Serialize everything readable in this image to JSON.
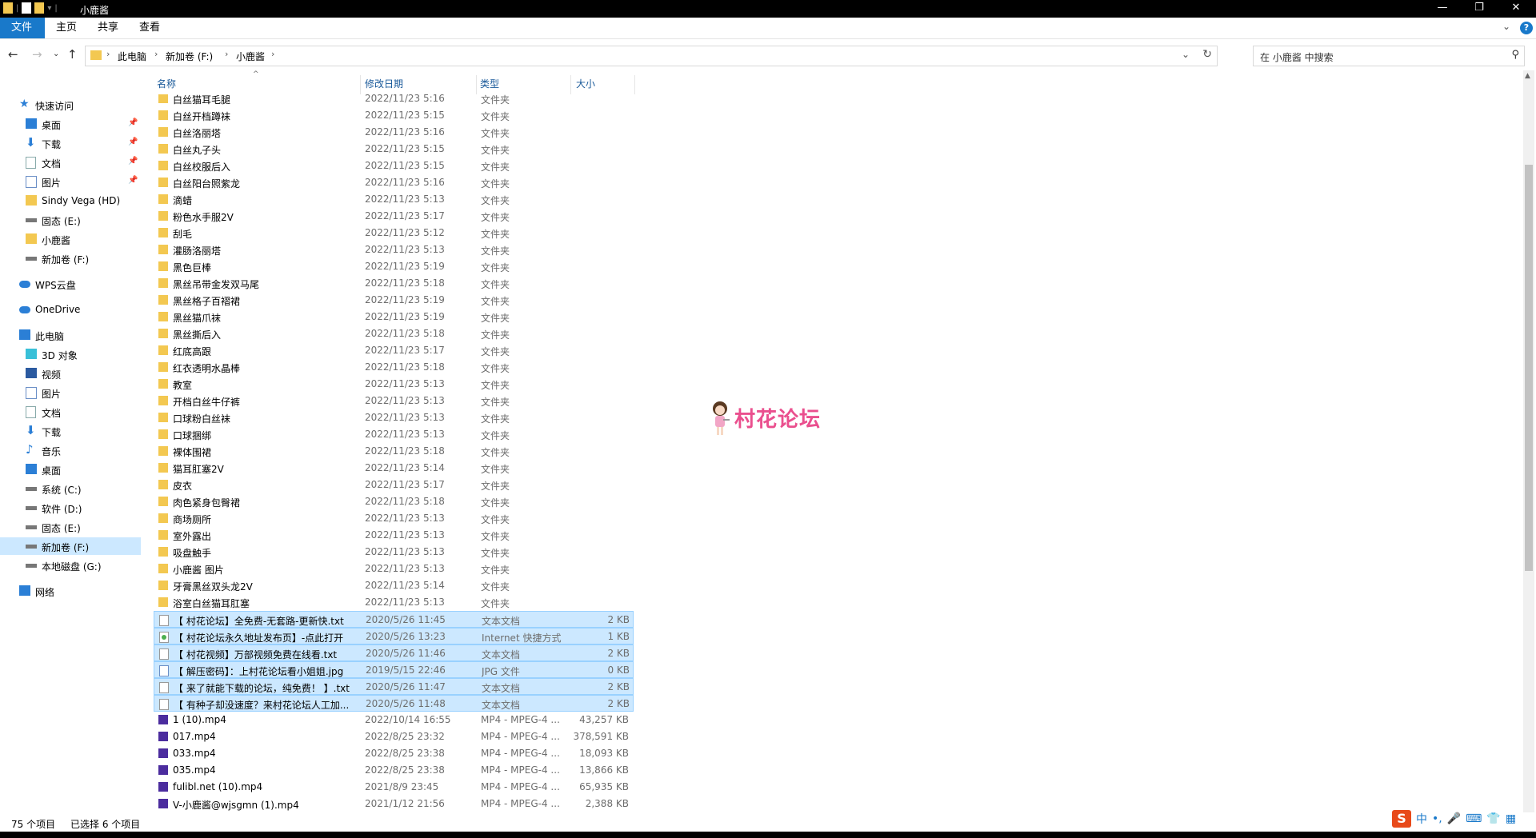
{
  "window": {
    "title": "小鹿酱"
  },
  "ribbon": {
    "tabs": [
      "文件",
      "主页",
      "共享",
      "查看"
    ]
  },
  "address": {
    "crumbs": [
      "此电脑",
      "新加卷 (F:)",
      "小鹿酱"
    ]
  },
  "search": {
    "placeholder": "在 小鹿酱 中搜索"
  },
  "sidebar": [
    {
      "label": "快速访问",
      "icon": "star-icon",
      "level": 0
    },
    {
      "label": "桌面",
      "icon": "desktop-icon",
      "level": 1,
      "pinned": true
    },
    {
      "label": "下载",
      "icon": "download-icon",
      "level": 1,
      "pinned": true
    },
    {
      "label": "文档",
      "icon": "document-icon",
      "level": 1,
      "pinned": true
    },
    {
      "label": "图片",
      "icon": "picture-icon",
      "level": 1,
      "pinned": true
    },
    {
      "label": "Sindy Vega (HD)",
      "icon": "folder-icon",
      "level": 1
    },
    {
      "label": "固态 (E:)",
      "icon": "drive-icon",
      "level": 1
    },
    {
      "label": "小鹿酱",
      "icon": "folder-icon",
      "level": 1
    },
    {
      "label": "新加卷 (F:)",
      "icon": "drive-icon",
      "level": 1
    },
    {
      "label": "WPS云盘",
      "icon": "cloud-icon",
      "level": 0
    },
    {
      "label": "OneDrive",
      "icon": "onedrive-icon",
      "level": 0
    },
    {
      "label": "此电脑",
      "icon": "computer-icon",
      "level": 0
    },
    {
      "label": "3D 对象",
      "icon": "cube-icon",
      "level": 1
    },
    {
      "label": "视频",
      "icon": "video-icon",
      "level": 1
    },
    {
      "label": "图片",
      "icon": "picture-icon",
      "level": 1
    },
    {
      "label": "文档",
      "icon": "document-icon",
      "level": 1
    },
    {
      "label": "下载",
      "icon": "download-icon",
      "level": 1
    },
    {
      "label": "音乐",
      "icon": "music-icon",
      "level": 1
    },
    {
      "label": "桌面",
      "icon": "desktop-icon",
      "level": 1
    },
    {
      "label": "系统 (C:)",
      "icon": "drive-icon",
      "level": 1
    },
    {
      "label": "软件 (D:)",
      "icon": "drive-icon",
      "level": 1
    },
    {
      "label": "固态 (E:)",
      "icon": "drive-icon",
      "level": 1
    },
    {
      "label": "新加卷 (F:)",
      "icon": "drive-icon",
      "level": 1,
      "selected": true
    },
    {
      "label": "本地磁盘 (G:)",
      "icon": "drive-icon",
      "level": 1
    },
    {
      "label": "网络",
      "icon": "network-icon",
      "level": 0
    }
  ],
  "columns": {
    "name": "名称",
    "date": "修改日期",
    "type": "类型",
    "size": "大小"
  },
  "files": [
    {
      "name": "白丝猫耳毛腿",
      "date": "2022/11/23 5:16",
      "type": "文件夹",
      "size": "",
      "kind": "folder"
    },
    {
      "name": "白丝开档蹲袜",
      "date": "2022/11/23 5:15",
      "type": "文件夹",
      "size": "",
      "kind": "folder"
    },
    {
      "name": "白丝洛丽塔",
      "date": "2022/11/23 5:16",
      "type": "文件夹",
      "size": "",
      "kind": "folder"
    },
    {
      "name": "白丝丸子头",
      "date": "2022/11/23 5:15",
      "type": "文件夹",
      "size": "",
      "kind": "folder"
    },
    {
      "name": "白丝校服后入",
      "date": "2022/11/23 5:15",
      "type": "文件夹",
      "size": "",
      "kind": "folder"
    },
    {
      "name": "白丝阳台照紫龙",
      "date": "2022/11/23 5:16",
      "type": "文件夹",
      "size": "",
      "kind": "folder"
    },
    {
      "name": "滴蜡",
      "date": "2022/11/23 5:13",
      "type": "文件夹",
      "size": "",
      "kind": "folder"
    },
    {
      "name": "粉色水手服2V",
      "date": "2022/11/23 5:17",
      "type": "文件夹",
      "size": "",
      "kind": "folder"
    },
    {
      "name": "刮毛",
      "date": "2022/11/23 5:12",
      "type": "文件夹",
      "size": "",
      "kind": "folder"
    },
    {
      "name": "灌肠洛丽塔",
      "date": "2022/11/23 5:13",
      "type": "文件夹",
      "size": "",
      "kind": "folder"
    },
    {
      "name": "黑色巨棒",
      "date": "2022/11/23 5:19",
      "type": "文件夹",
      "size": "",
      "kind": "folder"
    },
    {
      "name": "黑丝吊带金发双马尾",
      "date": "2022/11/23 5:18",
      "type": "文件夹",
      "size": "",
      "kind": "folder"
    },
    {
      "name": "黑丝格子百褶裙",
      "date": "2022/11/23 5:19",
      "type": "文件夹",
      "size": "",
      "kind": "folder"
    },
    {
      "name": "黑丝猫爪袜",
      "date": "2022/11/23 5:19",
      "type": "文件夹",
      "size": "",
      "kind": "folder"
    },
    {
      "name": "黑丝撕后入",
      "date": "2022/11/23 5:18",
      "type": "文件夹",
      "size": "",
      "kind": "folder"
    },
    {
      "name": "红底高跟",
      "date": "2022/11/23 5:17",
      "type": "文件夹",
      "size": "",
      "kind": "folder"
    },
    {
      "name": "红衣透明水晶棒",
      "date": "2022/11/23 5:18",
      "type": "文件夹",
      "size": "",
      "kind": "folder"
    },
    {
      "name": "教室",
      "date": "2022/11/23 5:13",
      "type": "文件夹",
      "size": "",
      "kind": "folder"
    },
    {
      "name": "开档白丝牛仔裤",
      "date": "2022/11/23 5:13",
      "type": "文件夹",
      "size": "",
      "kind": "folder"
    },
    {
      "name": "口球粉白丝袜",
      "date": "2022/11/23 5:13",
      "type": "文件夹",
      "size": "",
      "kind": "folder"
    },
    {
      "name": "口球捆绑",
      "date": "2022/11/23 5:13",
      "type": "文件夹",
      "size": "",
      "kind": "folder"
    },
    {
      "name": "裸体围裙",
      "date": "2022/11/23 5:18",
      "type": "文件夹",
      "size": "",
      "kind": "folder"
    },
    {
      "name": "猫耳肛塞2V",
      "date": "2022/11/23 5:14",
      "type": "文件夹",
      "size": "",
      "kind": "folder"
    },
    {
      "name": "皮衣",
      "date": "2022/11/23 5:17",
      "type": "文件夹",
      "size": "",
      "kind": "folder"
    },
    {
      "name": "肉色紧身包臀裙",
      "date": "2022/11/23 5:18",
      "type": "文件夹",
      "size": "",
      "kind": "folder"
    },
    {
      "name": "商场厕所",
      "date": "2022/11/23 5:13",
      "type": "文件夹",
      "size": "",
      "kind": "folder"
    },
    {
      "name": "室外露出",
      "date": "2022/11/23 5:13",
      "type": "文件夹",
      "size": "",
      "kind": "folder"
    },
    {
      "name": "吸盘触手",
      "date": "2022/11/23 5:13",
      "type": "文件夹",
      "size": "",
      "kind": "folder"
    },
    {
      "name": "小鹿酱 图片",
      "date": "2022/11/23 5:13",
      "type": "文件夹",
      "size": "",
      "kind": "folder"
    },
    {
      "name": "牙膏黑丝双头龙2V",
      "date": "2022/11/23 5:14",
      "type": "文件夹",
      "size": "",
      "kind": "folder"
    },
    {
      "name": "浴室白丝猫耳肛塞",
      "date": "2022/11/23 5:13",
      "type": "文件夹",
      "size": "",
      "kind": "folder"
    },
    {
      "name": "【 村花论坛】全免费-无套路-更新快.txt",
      "date": "2020/5/26 11:45",
      "type": "文本文档",
      "size": "2 KB",
      "kind": "txt",
      "selected": true
    },
    {
      "name": "【 村花论坛永久地址发布页】-点此打开",
      "date": "2020/5/26 13:23",
      "type": "Internet 快捷方式",
      "size": "1 KB",
      "kind": "url",
      "selected": true
    },
    {
      "name": "【 村花视频】万部视频免费在线看.txt",
      "date": "2020/5/26 11:46",
      "type": "文本文档",
      "size": "2 KB",
      "kind": "txt",
      "selected": true
    },
    {
      "name": "【 解压密码】：上村花论坛看小姐姐.jpg",
      "date": "2019/5/15 22:46",
      "type": "JPG 文件",
      "size": "0 KB",
      "kind": "jpg",
      "selected": true
    },
    {
      "name": "【 来了就能下载的论坛，纯免费！ 】.txt",
      "date": "2020/5/26 11:47",
      "type": "文本文档",
      "size": "2 KB",
      "kind": "txt",
      "selected": true
    },
    {
      "name": "【 有种子却没速度？来村花论坛人工加...",
      "date": "2020/5/26 11:48",
      "type": "文本文档",
      "size": "2 KB",
      "kind": "txt",
      "selected": true
    },
    {
      "name": "1 (10).mp4",
      "date": "2022/10/14 16:55",
      "type": "MP4 - MPEG-4 ...",
      "size": "43,257 KB",
      "kind": "mp4"
    },
    {
      "name": "017.mp4",
      "date": "2022/8/25 23:32",
      "type": "MP4 - MPEG-4 ...",
      "size": "378,591 KB",
      "kind": "mp4"
    },
    {
      "name": "033.mp4",
      "date": "2022/8/25 23:38",
      "type": "MP4 - MPEG-4 ...",
      "size": "18,093 KB",
      "kind": "mp4"
    },
    {
      "name": "035.mp4",
      "date": "2022/8/25 23:38",
      "type": "MP4 - MPEG-4 ...",
      "size": "13,866 KB",
      "kind": "mp4"
    },
    {
      "name": "fulibl.net (10).mp4",
      "date": "2021/8/9 23:45",
      "type": "MP4 - MPEG-4 ...",
      "size": "65,935 KB",
      "kind": "mp4"
    },
    {
      "name": "V-小鹿酱@wjsgmn (1).mp4",
      "date": "2021/1/12 21:56",
      "type": "MP4 - MPEG-4 ...",
      "size": "2,388 KB",
      "kind": "mp4"
    }
  ],
  "status": {
    "count": "75 个项目",
    "selected": "已选择 6 个项目"
  },
  "watermark": {
    "text": "村花论坛"
  },
  "ime": {
    "mode": "中"
  },
  "colors": {
    "accent": "#1979ca",
    "selection": "#cce8ff",
    "folder": "#f3c851",
    "watermark": "#ea4f8e"
  }
}
